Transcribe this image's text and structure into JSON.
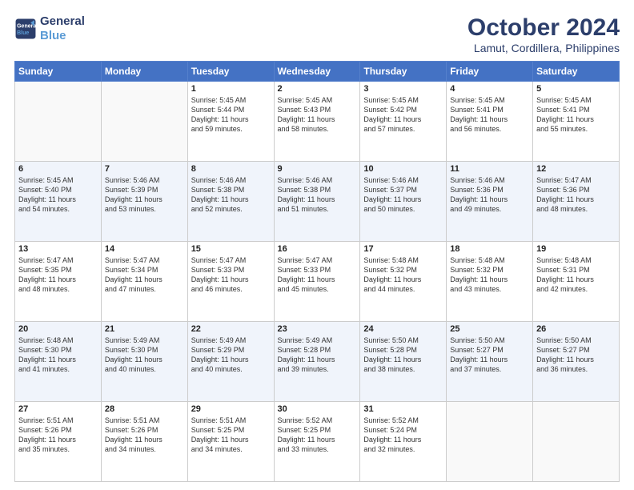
{
  "logo": {
    "line1": "General",
    "line2": "Blue"
  },
  "title": "October 2024",
  "subtitle": "Lamut, Cordillera, Philippines",
  "days_header": [
    "Sunday",
    "Monday",
    "Tuesday",
    "Wednesday",
    "Thursday",
    "Friday",
    "Saturday"
  ],
  "weeks": [
    [
      {
        "day": "",
        "text": ""
      },
      {
        "day": "",
        "text": ""
      },
      {
        "day": "1",
        "text": "Sunrise: 5:45 AM\nSunset: 5:44 PM\nDaylight: 11 hours\nand 59 minutes."
      },
      {
        "day": "2",
        "text": "Sunrise: 5:45 AM\nSunset: 5:43 PM\nDaylight: 11 hours\nand 58 minutes."
      },
      {
        "day": "3",
        "text": "Sunrise: 5:45 AM\nSunset: 5:42 PM\nDaylight: 11 hours\nand 57 minutes."
      },
      {
        "day": "4",
        "text": "Sunrise: 5:45 AM\nSunset: 5:41 PM\nDaylight: 11 hours\nand 56 minutes."
      },
      {
        "day": "5",
        "text": "Sunrise: 5:45 AM\nSunset: 5:41 PM\nDaylight: 11 hours\nand 55 minutes."
      }
    ],
    [
      {
        "day": "6",
        "text": "Sunrise: 5:45 AM\nSunset: 5:40 PM\nDaylight: 11 hours\nand 54 minutes."
      },
      {
        "day": "7",
        "text": "Sunrise: 5:46 AM\nSunset: 5:39 PM\nDaylight: 11 hours\nand 53 minutes."
      },
      {
        "day": "8",
        "text": "Sunrise: 5:46 AM\nSunset: 5:38 PM\nDaylight: 11 hours\nand 52 minutes."
      },
      {
        "day": "9",
        "text": "Sunrise: 5:46 AM\nSunset: 5:38 PM\nDaylight: 11 hours\nand 51 minutes."
      },
      {
        "day": "10",
        "text": "Sunrise: 5:46 AM\nSunset: 5:37 PM\nDaylight: 11 hours\nand 50 minutes."
      },
      {
        "day": "11",
        "text": "Sunrise: 5:46 AM\nSunset: 5:36 PM\nDaylight: 11 hours\nand 49 minutes."
      },
      {
        "day": "12",
        "text": "Sunrise: 5:47 AM\nSunset: 5:36 PM\nDaylight: 11 hours\nand 48 minutes."
      }
    ],
    [
      {
        "day": "13",
        "text": "Sunrise: 5:47 AM\nSunset: 5:35 PM\nDaylight: 11 hours\nand 48 minutes."
      },
      {
        "day": "14",
        "text": "Sunrise: 5:47 AM\nSunset: 5:34 PM\nDaylight: 11 hours\nand 47 minutes."
      },
      {
        "day": "15",
        "text": "Sunrise: 5:47 AM\nSunset: 5:33 PM\nDaylight: 11 hours\nand 46 minutes."
      },
      {
        "day": "16",
        "text": "Sunrise: 5:47 AM\nSunset: 5:33 PM\nDaylight: 11 hours\nand 45 minutes."
      },
      {
        "day": "17",
        "text": "Sunrise: 5:48 AM\nSunset: 5:32 PM\nDaylight: 11 hours\nand 44 minutes."
      },
      {
        "day": "18",
        "text": "Sunrise: 5:48 AM\nSunset: 5:32 PM\nDaylight: 11 hours\nand 43 minutes."
      },
      {
        "day": "19",
        "text": "Sunrise: 5:48 AM\nSunset: 5:31 PM\nDaylight: 11 hours\nand 42 minutes."
      }
    ],
    [
      {
        "day": "20",
        "text": "Sunrise: 5:48 AM\nSunset: 5:30 PM\nDaylight: 11 hours\nand 41 minutes."
      },
      {
        "day": "21",
        "text": "Sunrise: 5:49 AM\nSunset: 5:30 PM\nDaylight: 11 hours\nand 40 minutes."
      },
      {
        "day": "22",
        "text": "Sunrise: 5:49 AM\nSunset: 5:29 PM\nDaylight: 11 hours\nand 40 minutes."
      },
      {
        "day": "23",
        "text": "Sunrise: 5:49 AM\nSunset: 5:28 PM\nDaylight: 11 hours\nand 39 minutes."
      },
      {
        "day": "24",
        "text": "Sunrise: 5:50 AM\nSunset: 5:28 PM\nDaylight: 11 hours\nand 38 minutes."
      },
      {
        "day": "25",
        "text": "Sunrise: 5:50 AM\nSunset: 5:27 PM\nDaylight: 11 hours\nand 37 minutes."
      },
      {
        "day": "26",
        "text": "Sunrise: 5:50 AM\nSunset: 5:27 PM\nDaylight: 11 hours\nand 36 minutes."
      }
    ],
    [
      {
        "day": "27",
        "text": "Sunrise: 5:51 AM\nSunset: 5:26 PM\nDaylight: 11 hours\nand 35 minutes."
      },
      {
        "day": "28",
        "text": "Sunrise: 5:51 AM\nSunset: 5:26 PM\nDaylight: 11 hours\nand 34 minutes."
      },
      {
        "day": "29",
        "text": "Sunrise: 5:51 AM\nSunset: 5:25 PM\nDaylight: 11 hours\nand 34 minutes."
      },
      {
        "day": "30",
        "text": "Sunrise: 5:52 AM\nSunset: 5:25 PM\nDaylight: 11 hours\nand 33 minutes."
      },
      {
        "day": "31",
        "text": "Sunrise: 5:52 AM\nSunset: 5:24 PM\nDaylight: 11 hours\nand 32 minutes."
      },
      {
        "day": "",
        "text": ""
      },
      {
        "day": "",
        "text": ""
      }
    ]
  ]
}
